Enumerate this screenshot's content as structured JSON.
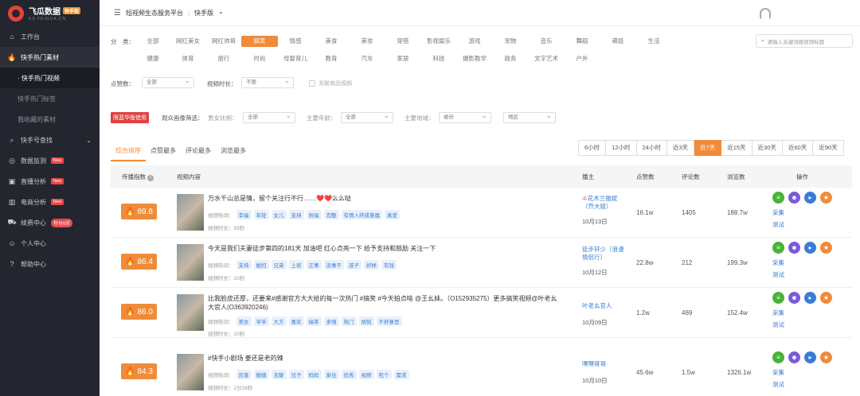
{
  "sidebar": {
    "logo_title": "飞瓜数据",
    "logo_badge": "快手版",
    "logo_sub": "KS.FEIGUA.CN",
    "items": [
      {
        "label": "工作台",
        "icon": "home-icon"
      },
      {
        "label": "快手热门素材",
        "icon": "fire-icon"
      },
      {
        "label": "· 快手热门视频",
        "icon": ""
      },
      {
        "label": "快手热门标签",
        "icon": ""
      },
      {
        "label": "我收藏的素材",
        "icon": ""
      },
      {
        "label": "快手号查找",
        "icon": "search-icon"
      },
      {
        "label": "数据监测",
        "icon": "monitor-icon",
        "badge": "New"
      },
      {
        "label": "直播分析",
        "icon": "live-icon",
        "badge": "New"
      },
      {
        "label": "电商分析",
        "icon": "chart-icon",
        "badge": "New"
      },
      {
        "label": "续费中心",
        "icon": "cart-icon",
        "badge": "年付6折"
      },
      {
        "label": "个人中心",
        "icon": "user-icon"
      },
      {
        "label": "帮助中心",
        "icon": "help-icon"
      }
    ]
  },
  "topbar": {
    "platform": "短视频生态服务平台",
    "separator": "|",
    "version": "快手版"
  },
  "filters": {
    "category_label": "分　类：",
    "categories_row1": [
      "全部",
      "网红美女",
      "网红帅哥",
      "搞笑",
      "情感",
      "美食",
      "美妆",
      "穿搭",
      "影视娱乐",
      "游戏",
      "宠物",
      "音乐",
      "舞蹈",
      "萌娃",
      "生活"
    ],
    "categories_row2": [
      "健康",
      "体育",
      "旅行",
      "时尚",
      "母婴育儿",
      "教育",
      "汽车",
      "家居",
      "科技",
      "摄影教学",
      "政务",
      "文字艺术",
      "户外"
    ],
    "active_category": "搞笑",
    "search_placeholder": "请输入关键词搜视频标题",
    "likes_label": "点赞数：",
    "likes_value": "全部",
    "duration_label": "视频时长：",
    "duration_value": "不限",
    "product_check_label": "关联商品视频",
    "audience_flag": "限蓝华版使用",
    "audience_label": "观众画像筛选：",
    "gender_label": "男女比例：",
    "gender_value": "全部",
    "age_label": "主要年龄：",
    "age_value": "全部",
    "region_label": "主要地域：",
    "region_value": "省份",
    "city_value": "地区"
  },
  "sort_tabs": [
    "综合排序",
    "点赞最多",
    "评论最多",
    "浏览最多"
  ],
  "time_ranges": [
    "6小时",
    "12小时",
    "24小时",
    "近3天",
    "近7天",
    "近15天",
    "近30天",
    "近60天",
    "近90天"
  ],
  "active_time_range": "近7天",
  "table": {
    "headers": {
      "score": "传播指数",
      "content": "视频内容",
      "author": "播主",
      "likes": "点赞数",
      "comments": "评论数",
      "views": "浏览数",
      "ops": "操作"
    },
    "hot_label": "视频热词：",
    "dur_prefix": "视频时长：",
    "collect": "采集",
    "test": "测试",
    "rows": [
      {
        "score": "89.8",
        "title": "万水千山总是情，留个关注行不行……❤️❤️么么哒",
        "tags": [
          "幸福",
          "年轻",
          "女儿",
          "支持",
          "祝福",
          "完整",
          "有情人终成眷属",
          "真爱"
        ],
        "duration": "59秒",
        "author": "花木兰傲妮（乔大姐）",
        "date": "10月13日",
        "likes": "16.1w",
        "comments": "1405",
        "views": "188.7w"
      },
      {
        "score": "86.4",
        "title": "今天是我们夫妻徒步第四的181天 加油吧 红心点亮一下 给予支持和鼓励 关注一下",
        "tags": [
          "支持",
          "媳妇",
          "兄弟",
          "上班",
          "正事",
          "没事干",
          "孩子",
          "好样",
          "有钱"
        ],
        "duration": "20秒",
        "author": "徒步轩少（浪漫情侣行）",
        "date": "10月12日",
        "likes": "22.8w",
        "comments": "212",
        "views": "199.3w"
      },
      {
        "score": "86.0",
        "title": "比我脸皮还厚，还要来#感谢官方大大给的每一次热门 #搞笑 #今天拍点啥 @王幺妹。（O152935275）更多搞笑视频@叶老幺大官人(O363920246)",
        "tags": [
          "美女",
          "爷爷",
          "大方",
          "喜欢",
          "搞笑",
          "多强",
          "热门",
          "胡侃",
          "不好意思"
        ],
        "duration": "20秒",
        "author": "叶老幺官人",
        "date": "10月09日",
        "likes": "1.2w",
        "comments": "469",
        "views": "152.4w"
      },
      {
        "score": "84.3",
        "title": "#快手小剧场 姜还是老的辣",
        "tags": [
          "厉害",
          "嫂嫂",
          "无聊",
          "兄子",
          "妈妈",
          "家住",
          "优秀",
          "视频",
          "吃个",
          "需求"
        ],
        "duration": "2分28秒",
        "author": "嘿嘿哥哥",
        "date": "10月10日",
        "likes": "45.6w",
        "comments": "1.5w",
        "views": "1326.1w"
      }
    ]
  },
  "colors": {
    "accent": "#f08b3a",
    "sidebar": "#23262e",
    "link": "#3a7bd5"
  }
}
